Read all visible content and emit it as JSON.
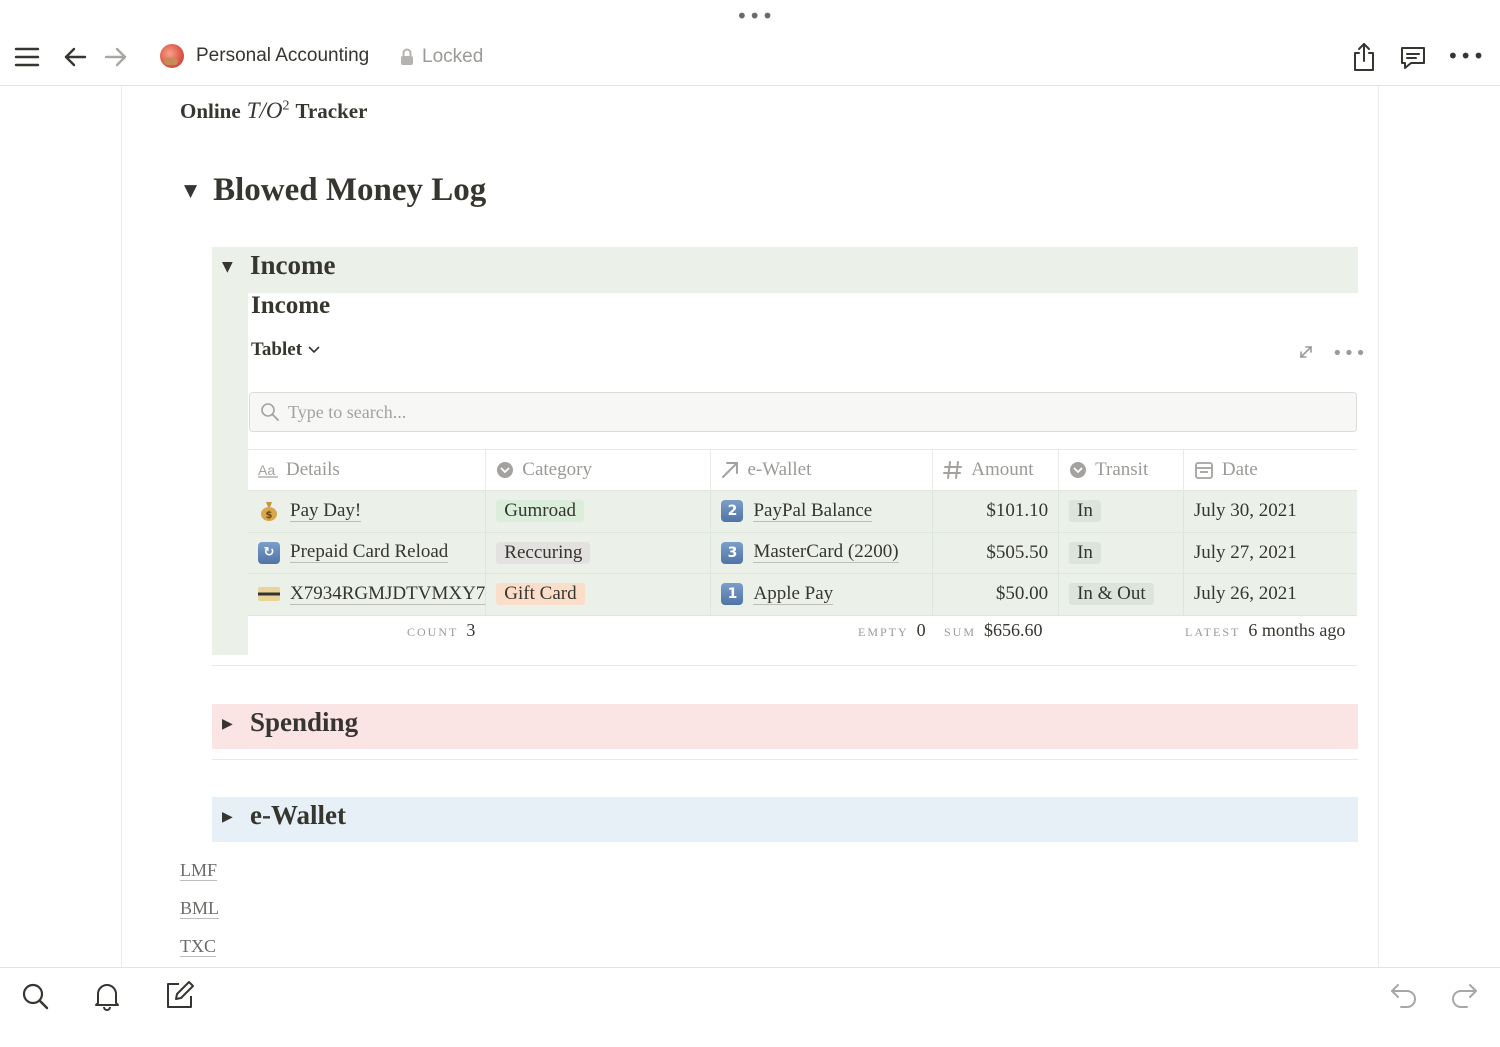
{
  "toolbar": {
    "page_title": "Personal Accounting",
    "locked_label": "Locked",
    "top_handle": "•••",
    "more_label": "•••"
  },
  "page": {
    "tracker_prefix": "Online",
    "tracker_math_t": "T",
    "tracker_math_slash": "/",
    "tracker_math_o": "O",
    "tracker_math_sup": "2",
    "tracker_suffix": "Tracker",
    "heading": "Blowed Money Log"
  },
  "sections": {
    "income": {
      "title": "Income",
      "db_title": "Income",
      "view_label": "Tablet",
      "search_placeholder": "Type to search...",
      "columns": [
        {
          "label": "Details",
          "icon": "text-type-icon"
        },
        {
          "label": "Category",
          "icon": "select-icon"
        },
        {
          "label": "e-Wallet",
          "icon": "relation-arrow-icon"
        },
        {
          "label": "Amount",
          "icon": "number-hash-icon"
        },
        {
          "label": "Transit",
          "icon": "select-icon"
        },
        {
          "label": "Date",
          "icon": "calendar-icon"
        }
      ],
      "rows": [
        {
          "icon": "money-bag-icon",
          "details": "Pay Day!",
          "category": "Gumroad",
          "category_color": "#dbeddb",
          "wallet_num": "2",
          "wallet": "PayPal Balance",
          "amount": "$101.10",
          "transit": "In",
          "date": "July 30, 2021"
        },
        {
          "icon": "repeat-icon",
          "details": "Prepaid Card Reload",
          "category": "Reccuring",
          "category_color": "#e3e2e0",
          "wallet_num": "3",
          "wallet": "MasterCard (2200)",
          "amount": "$505.50",
          "transit": "In",
          "date": "July 27, 2021"
        },
        {
          "icon": "credit-card-icon",
          "details": "X7934RGMJDTVMXY7",
          "category": "Gift Card",
          "category_color": "#fadec9",
          "wallet_num": "1",
          "wallet": "Apple Pay",
          "amount": "$50.00",
          "transit": "In & Out",
          "date": "July 26, 2021"
        }
      ],
      "calc": {
        "count_label": "COUNT",
        "count_value": "3",
        "empty_label": "EMPTY",
        "empty_value": "0",
        "sum_label": "SUM",
        "sum_value": "$656.60",
        "latest_label": "LATEST",
        "latest_value": "6 months ago"
      }
    },
    "spending": {
      "title": "Spending"
    },
    "ewallet": {
      "title": "e-Wallet"
    }
  },
  "links": [
    "LMF",
    "BML",
    "TXC"
  ],
  "colors": {
    "income_bg": "#ebf1e9",
    "spending_bg": "#fbe4e4",
    "ewallet_bg": "#e7f0f6"
  }
}
